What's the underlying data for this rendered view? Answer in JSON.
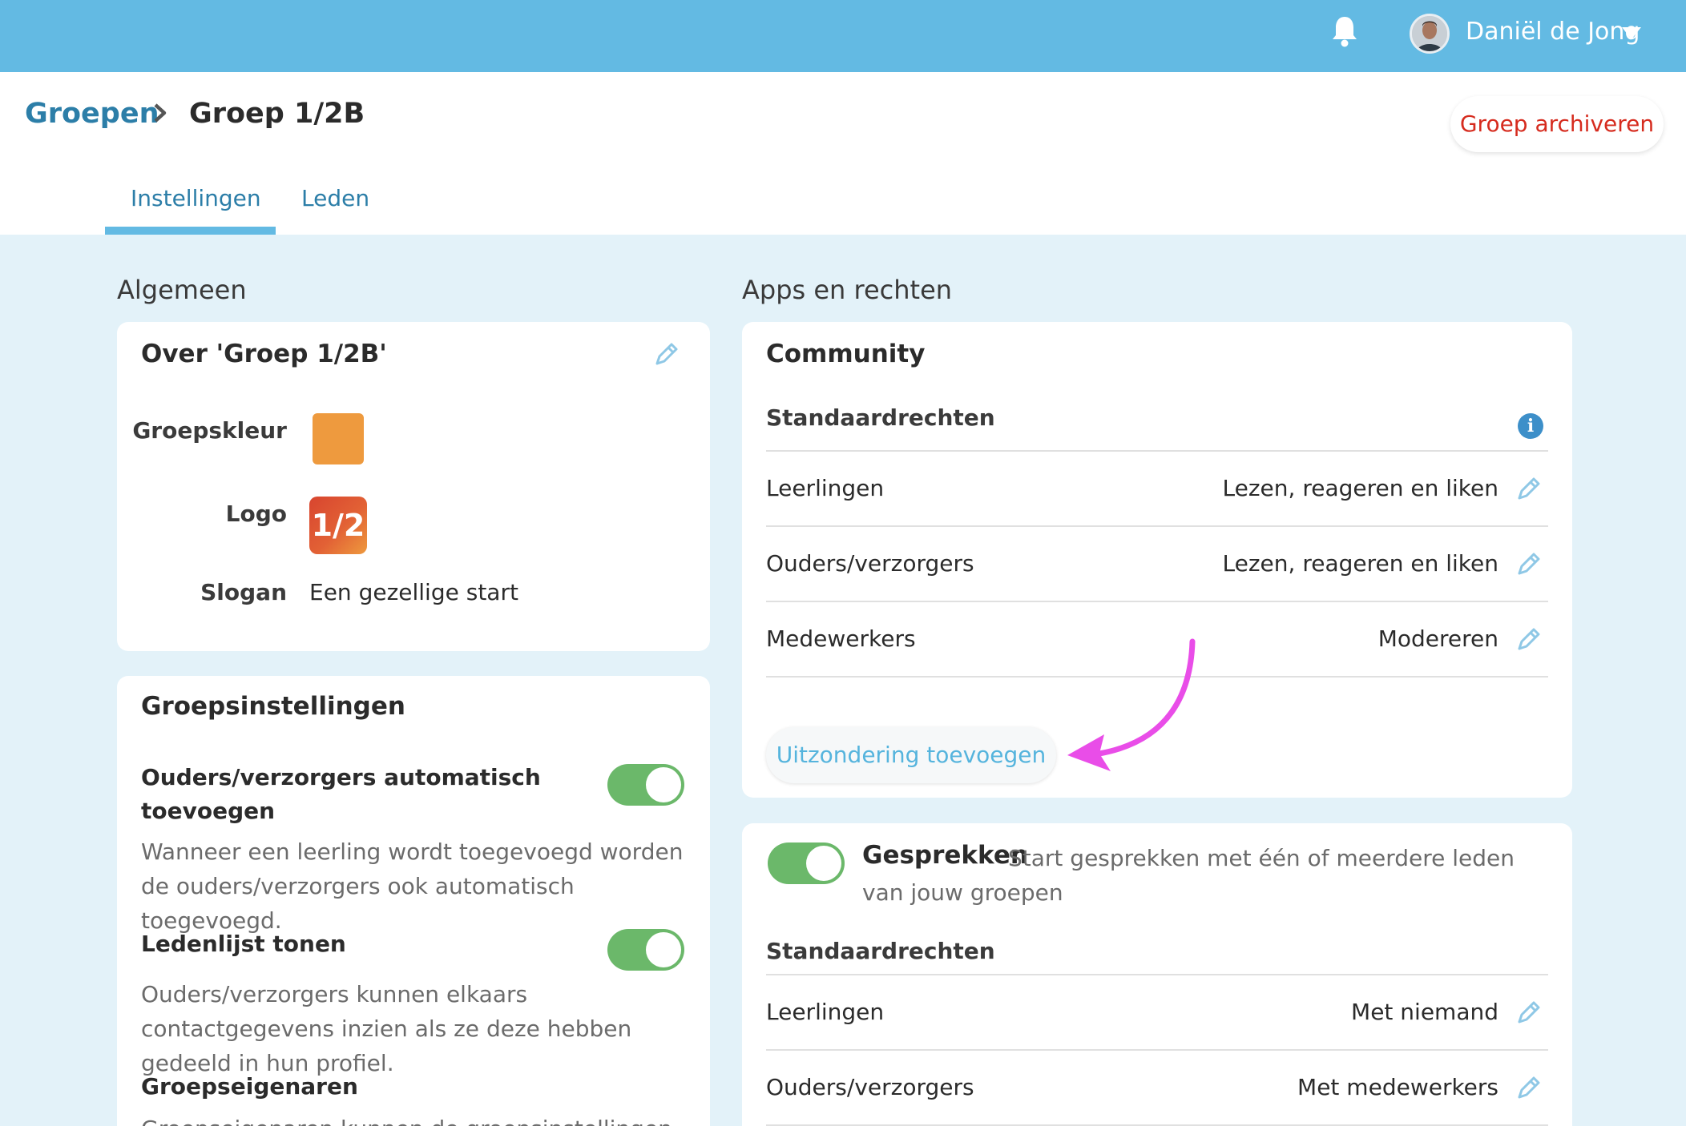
{
  "user": {
    "name": "Daniël de Jong"
  },
  "breadcrumb": {
    "root": "Groepen",
    "separator": ">",
    "current": "Groep 1/2B"
  },
  "header": {
    "archive_label": "Groep archiveren"
  },
  "tabs": [
    {
      "label": "Instellingen",
      "active": true
    },
    {
      "label": "Leden",
      "active": false
    }
  ],
  "sections": {
    "left_title": "Algemeen",
    "right_title": "Apps en rechten"
  },
  "over": {
    "title": "Over 'Groep 1/2B'",
    "color_label": "Groepskleur",
    "color_value": "#ee9a3e",
    "logo_label": "Logo",
    "logo_text": "1/2",
    "slogan_label": "Slogan",
    "slogan_value": "Een gezellige start"
  },
  "groepsinstellingen": {
    "title": "Groepsinstellingen",
    "settings": [
      {
        "title": "Ouders/verzorgers automatisch toevoegen",
        "description": "Wanneer een leerling wordt toegevoegd worden de ouders/verzorgers ook automatisch toegevoegd.",
        "enabled": true
      },
      {
        "title": "Ledenlijst tonen",
        "description": "Ouders/verzorgers kunnen elkaars contactgegevens inzien als ze deze hebben gedeeld in hun profiel.",
        "enabled": true
      },
      {
        "title": "Groepseigenaren",
        "description": "Groepseigenaren kunnen de groepsinstellingen"
      }
    ]
  },
  "community": {
    "title": "Community",
    "subhead": "Standaardrechten",
    "rows": [
      {
        "label": "Leerlingen",
        "value": "Lezen, reageren en liken"
      },
      {
        "label": "Ouders/verzorgers",
        "value": "Lezen, reageren en liken"
      },
      {
        "label": "Medewerkers",
        "value": "Modereren"
      }
    ],
    "exception_button": "Uitzondering toevoegen"
  },
  "gesprekken": {
    "title": "Gesprekken",
    "description": "Start gesprekken met één of meerdere leden van jouw groepen",
    "enabled": true,
    "subhead": "Standaardrechten",
    "rows": [
      {
        "label": "Leerlingen",
        "value": "Met niemand"
      },
      {
        "label": "Ouders/verzorgers",
        "value": "Met medewerkers"
      }
    ]
  },
  "colors": {
    "topbar": "#63bae3",
    "accent": "#2c7ea8",
    "danger": "#d62b1e",
    "toggle_on": "#6bb86a",
    "annotation_arrow": "#e94de8"
  }
}
